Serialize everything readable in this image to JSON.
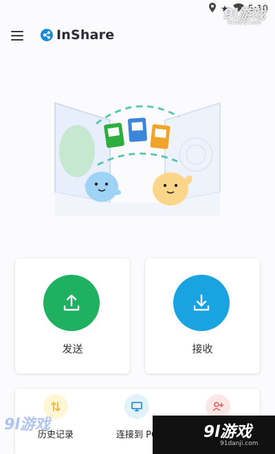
{
  "status": {
    "time": "5:10"
  },
  "app": {
    "title": "InShare"
  },
  "actions": {
    "send_label": "发送",
    "receive_label": "接收"
  },
  "tools": [
    {
      "label": "历史记录",
      "icon": "history-icon"
    },
    {
      "label": "连接到 PC",
      "icon": "monitor-icon"
    },
    {
      "label": "",
      "icon": "invite-friend-icon"
    }
  ],
  "watermark": {
    "brand": "9l游戏",
    "site": "91danji.com"
  },
  "colors": {
    "send": "#1fb061",
    "receive": "#19a3e0",
    "brand": "#1b8ad6"
  }
}
